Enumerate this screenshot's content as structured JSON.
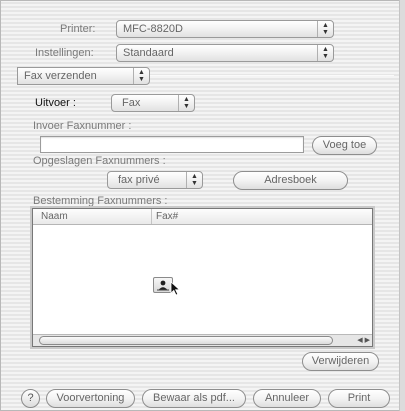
{
  "printer": {
    "label": "Printer:",
    "value": "MFC-8820D"
  },
  "settings": {
    "label": "Instellingen:",
    "value": "Standaard"
  },
  "pane": {
    "value": "Fax verzenden"
  },
  "output": {
    "label": "Uitvoer :",
    "value": "Fax"
  },
  "fax_number": {
    "label": "Invoer Faxnummer :",
    "value": "",
    "add_label": "Voeg toe"
  },
  "saved_numbers": {
    "label": "Opgeslagen Faxnummers :",
    "value": "fax privé",
    "addressbook_label": "Adresboek"
  },
  "destination": {
    "label": "Bestemming Faxnummers :",
    "columns": [
      "Naam",
      "Fax#"
    ],
    "rows": [],
    "remove_label": "Verwijderen"
  },
  "footer": {
    "help_label": "?",
    "preview_label": "Voorvertoning",
    "save_pdf_label": "Bewaar als pdf...",
    "cancel_label": "Annuleer",
    "print_label": "Print"
  },
  "icons": {
    "popup_arrows": "up-down-arrows-icon",
    "drop_target": "person-icon",
    "cursor": "arrow-cursor-icon"
  }
}
